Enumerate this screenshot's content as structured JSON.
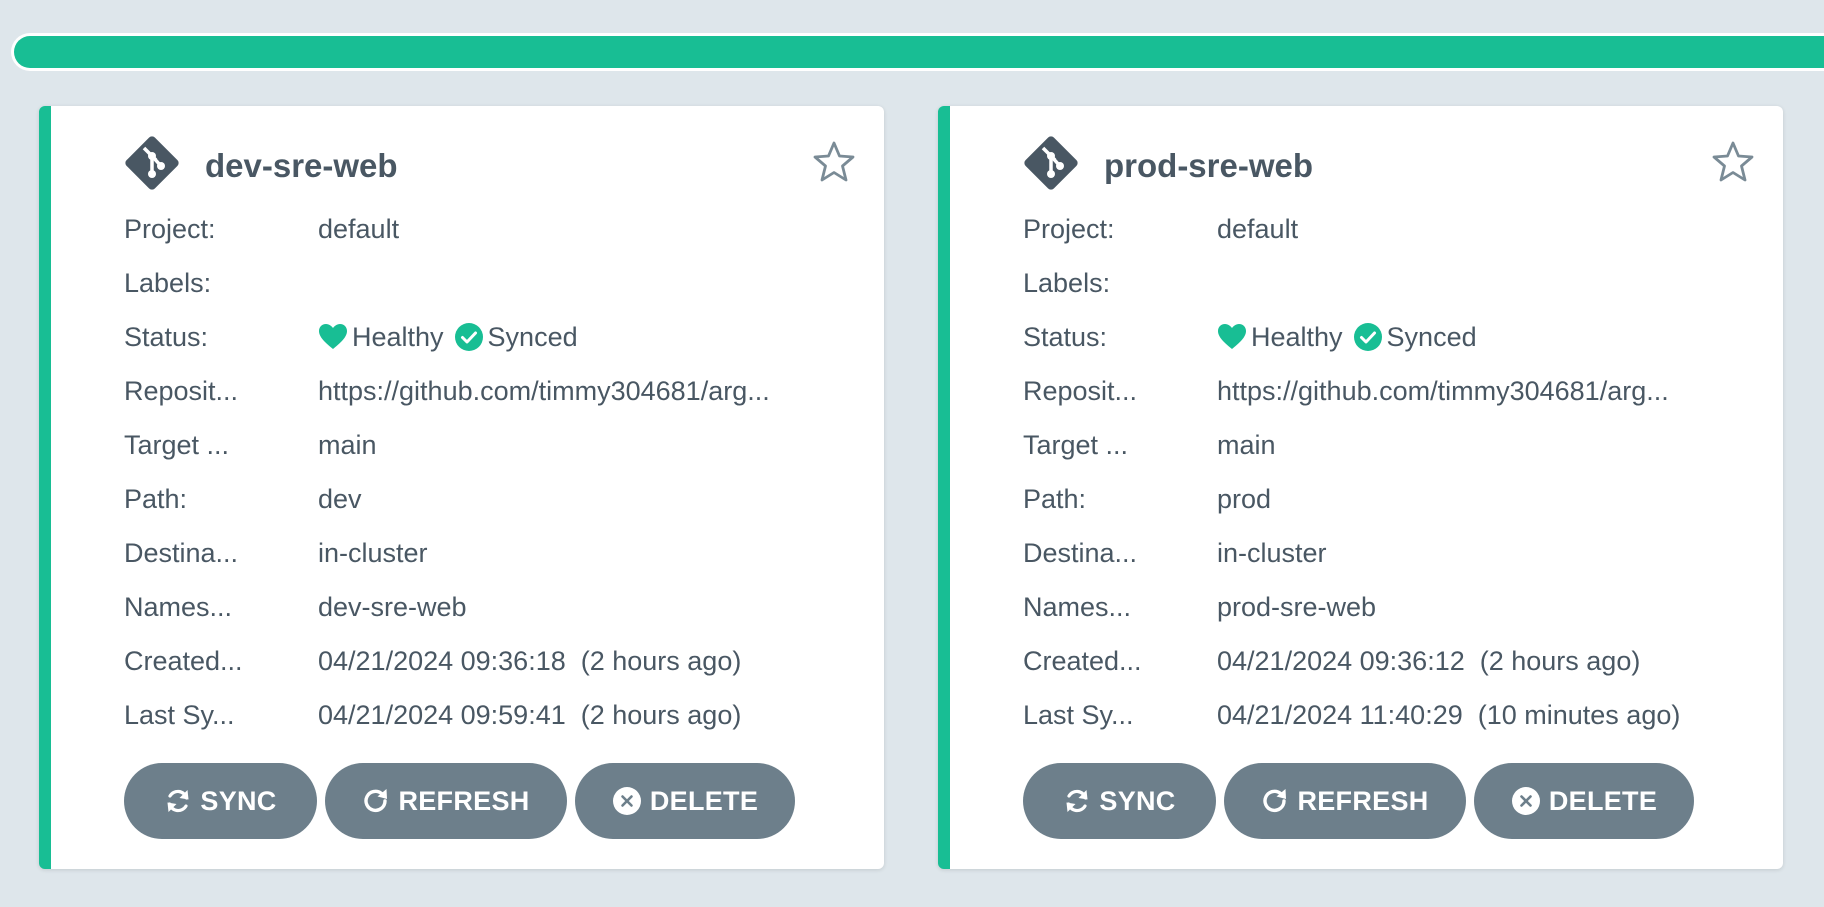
{
  "colors": {
    "accent": "#18be94",
    "button": "#6d7f8b",
    "text": "#495763",
    "background": "#dee6eb"
  },
  "labels": {
    "project": "Project:",
    "labels": "Labels:",
    "status": "Status:",
    "repository": "Reposit...",
    "target": "Target ...",
    "path": "Path:",
    "destination": "Destina...",
    "namespace": "Names...",
    "created": "Created...",
    "last_sync": "Last Sy..."
  },
  "buttons": {
    "sync": "SYNC",
    "refresh": "REFRESH",
    "delete": "DELETE"
  },
  "apps": [
    {
      "name": "dev-sre-web",
      "project": "default",
      "labels": "",
      "health": "Healthy",
      "sync_status": "Synced",
      "repository": "https://github.com/timmy304681/arg...",
      "target": "main",
      "path": "dev",
      "destination": "in-cluster",
      "namespace": "dev-sre-web",
      "created": "04/21/2024 09:36:18  (2 hours ago)",
      "last_sync": "04/21/2024 09:59:41  (2 hours ago)"
    },
    {
      "name": "prod-sre-web",
      "project": "default",
      "labels": "",
      "health": "Healthy",
      "sync_status": "Synced",
      "repository": "https://github.com/timmy304681/arg...",
      "target": "main",
      "path": "prod",
      "destination": "in-cluster",
      "namespace": "prod-sre-web",
      "created": "04/21/2024 09:36:12  (2 hours ago)",
      "last_sync": "04/21/2024 11:40:29  (10 minutes ago)"
    }
  ]
}
